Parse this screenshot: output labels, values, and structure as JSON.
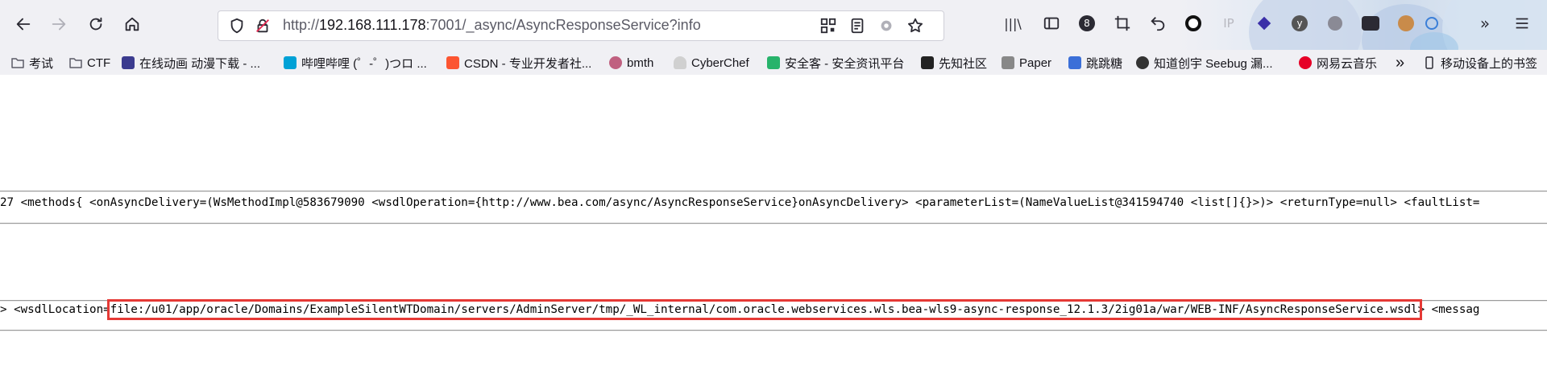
{
  "url": {
    "scheme": "http://",
    "host": "192.168.111.178",
    "rest": ":7001/_async/AsyncResponseService?info"
  },
  "bookmarks": [
    {
      "label": "考试",
      "icon": "folder-icon",
      "color": "#5b5b66"
    },
    {
      "label": "CTF",
      "icon": "folder-icon",
      "color": "#5b5b66"
    },
    {
      "label": "在线动画 动漫下载 - ...",
      "icon": "anime-favicon",
      "color": "#3b3b8f"
    },
    {
      "label": "哔哩哔哩 (゜-゜)つロ ...",
      "icon": "bilibili-icon",
      "color": "#00a1d6"
    },
    {
      "label": "CSDN - 专业开发者社...",
      "icon": "csdn-icon",
      "color": "#fc5531"
    },
    {
      "label": "bmth",
      "icon": "avatar-favicon",
      "color": "#c06080"
    },
    {
      "label": "CyberChef",
      "icon": "chef-hat-icon",
      "color": "#d0d0d0"
    },
    {
      "label": "安全客 - 安全资讯平台",
      "icon": "anquanke-icon",
      "color": "#27b36b"
    },
    {
      "label": "先知社区",
      "icon": "xianzhi-icon",
      "color": "#222222"
    },
    {
      "label": "Paper",
      "icon": "paper-icon",
      "color": "#888888"
    },
    {
      "label": "跳跳糖",
      "icon": "tiaotiaotang-icon",
      "color": "#3b6fd8"
    },
    {
      "label": "知道创宇 Seebug 漏...",
      "icon": "seebug-icon",
      "color": "#333333"
    },
    {
      "label": "网易云音乐",
      "icon": "netease-music-icon",
      "color": "#e60026"
    },
    {
      "label": "移动设备上的书签",
      "icon": "mobile-bookmarks-icon",
      "color": "#2b2a33"
    }
  ],
  "content": {
    "line1": "27 <methods{ <onAsyncDelivery=(WsMethodImpl@583679090 <wsdlOperation={http://www.bea.com/async/AsyncResponseService}onAsyncDelivery> <parameterList=(NameValueList@341594740 <list[]{}>)> <returnType=null> <faultList=",
    "line2_prefix": "> <wsdlLocation=",
    "line2_highlight": "file:/u01/app/oracle/Domains/ExampleSilentWTDomain/servers/AdminServer/tmp/_WL_internal/com.oracle.webservices.wls.bea-wls9-async-response_12.1.3/2ig01a/war/WEB-INF/AsyncResponseService.wsdl",
    "line2_suffix": "> <messag"
  },
  "colors": {
    "highlight_border": "#e53935",
    "toolbar_bg": "#f0f0f4"
  }
}
